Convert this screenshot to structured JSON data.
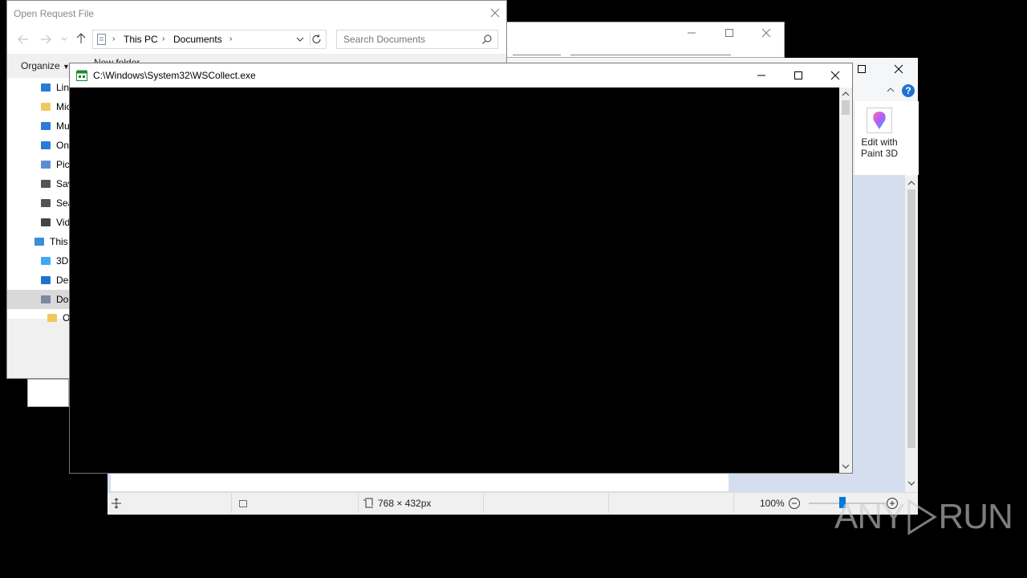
{
  "paint_window": {
    "status_bar": {
      "dimensions": "768 × 432px",
      "zoom": "100%"
    },
    "ribbon": {
      "paint3d_label_line1": "Edit with",
      "paint3d_label_line2": "Paint 3D"
    }
  },
  "file_dialog": {
    "title": "Open Request File",
    "breadcrumb": [
      "This PC",
      "Documents"
    ],
    "search_placeholder": "Search Documents",
    "toolbar": {
      "organize": "Organize",
      "new_folder": "New folder"
    },
    "tree": [
      {
        "label": "Lin",
        "icon": "link-icon"
      },
      {
        "label": "Mic",
        "icon": "folder-icon"
      },
      {
        "label": "Mu",
        "icon": "music-icon"
      },
      {
        "label": "On",
        "icon": "cloud-icon"
      },
      {
        "label": "Pic",
        "icon": "pictures-icon"
      },
      {
        "label": "Sav",
        "icon": "saved-games-icon"
      },
      {
        "label": "Sea",
        "icon": "search-icon"
      },
      {
        "label": "Vid",
        "icon": "videos-icon"
      },
      {
        "label": "This",
        "icon": "computer-icon"
      },
      {
        "label": "3D",
        "icon": "3d-objects-icon"
      },
      {
        "label": "Des",
        "icon": "desktop-icon"
      },
      {
        "label": "Doc",
        "icon": "documents-icon"
      },
      {
        "label": "O",
        "icon": "folder-icon"
      }
    ]
  },
  "console_window": {
    "title": "C:\\Windows\\System32\\WSCollect.exe"
  },
  "watermark": {
    "left": "ANY",
    "right": "RUN"
  },
  "colors": {
    "accent": "#0078d7",
    "console_bg": "#000000",
    "paint_canvas_bg": "#d5deef"
  }
}
